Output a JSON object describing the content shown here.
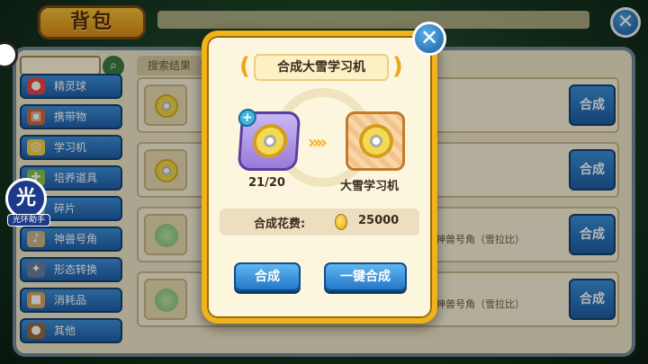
{
  "backpack": {
    "title": "背包",
    "search_tab_label": "搜索结果",
    "categories": [
      {
        "label": "精灵球",
        "icon": "pokeball-icon"
      },
      {
        "label": "携带物",
        "icon": "bag-item-icon"
      },
      {
        "label": "学习机",
        "icon": "disc-icon"
      },
      {
        "label": "培养道具",
        "icon": "training-icon"
      },
      {
        "label": "碎片",
        "icon": "fragment-icon"
      },
      {
        "label": "神兽号角",
        "icon": "horn-icon"
      },
      {
        "label": "形态转换",
        "icon": "transform-icon"
      },
      {
        "label": "消耗品",
        "icon": "box-icon"
      },
      {
        "label": "其他",
        "icon": "misc-icon"
      }
    ],
    "rows": [
      {
        "synth_label": "合成",
        "name": ""
      },
      {
        "synth_label": "合成",
        "name": ""
      },
      {
        "synth_label": "合成",
        "name": "神兽号角（雪拉比）"
      },
      {
        "synth_label": "合成",
        "name": "神兽号角（雪拉比）"
      }
    ]
  },
  "side_tool": {
    "glyph": "光",
    "label": "光环助手"
  },
  "modal": {
    "title": "合成大雪学习机",
    "source_count": "21/20",
    "result_name": "大雪学习机",
    "cost_label": "合成花费:",
    "cost_value": "25000",
    "synth_button": "合成",
    "one_key_button": "一键合成"
  },
  "colors": {
    "accent_gold": "#f1b21a",
    "button_blue": "#2477c9"
  }
}
